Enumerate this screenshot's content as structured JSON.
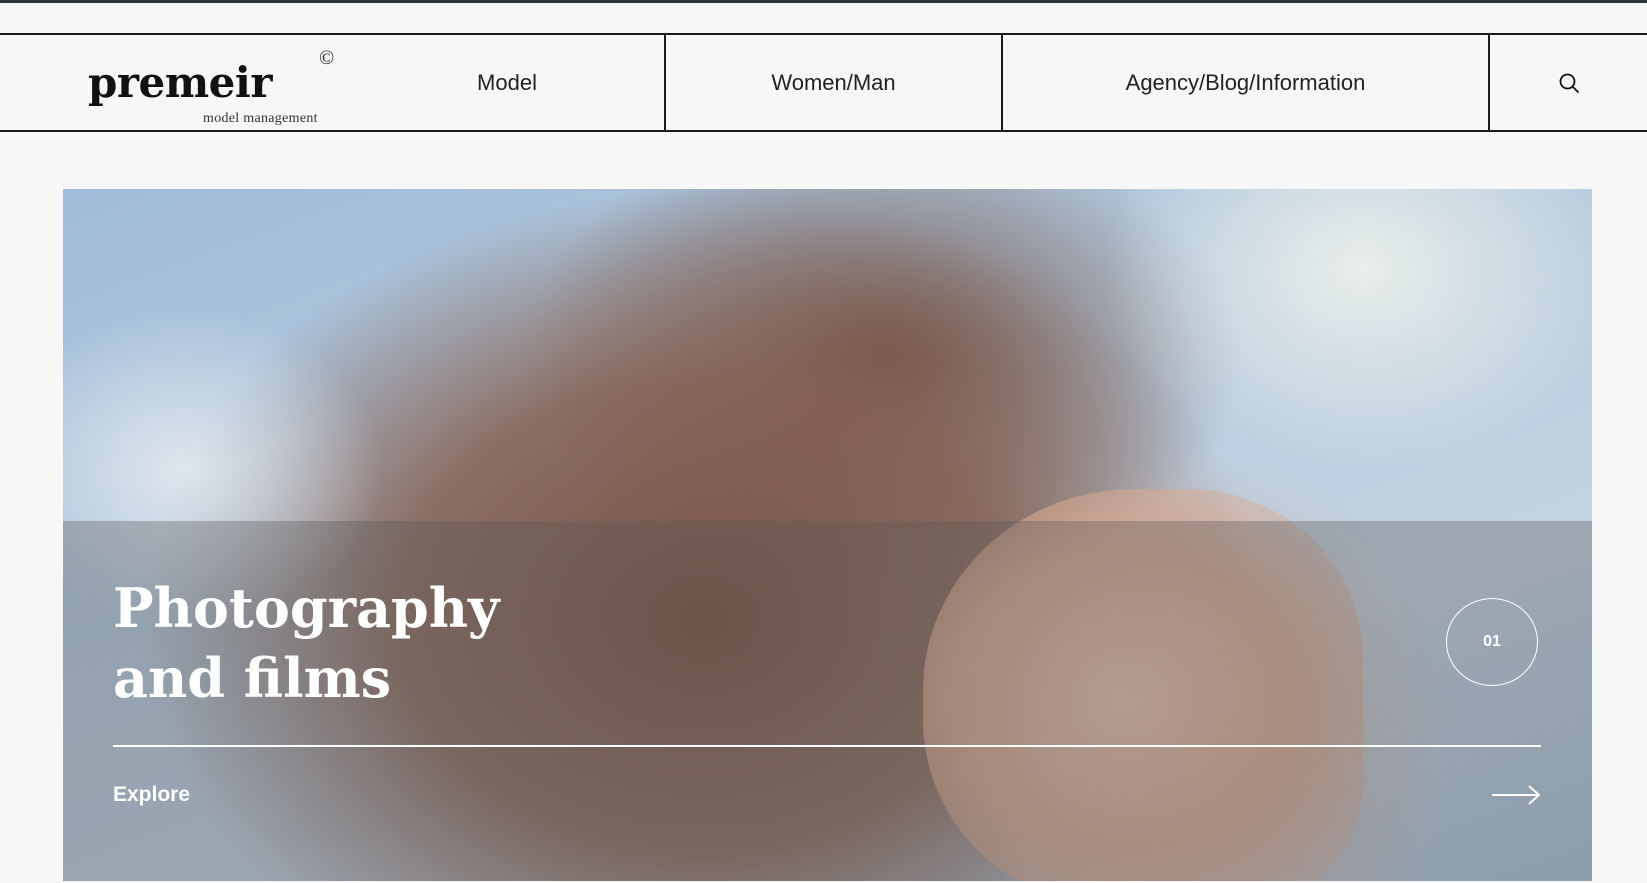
{
  "brand": {
    "name": "premeir",
    "copyright_mark": "©",
    "tagline": "model management"
  },
  "nav": {
    "items": [
      {
        "label": "Model"
      },
      {
        "label": "Women/Man"
      },
      {
        "label": "Agency/Blog/Information"
      }
    ],
    "search_icon": "search-icon"
  },
  "hero": {
    "title": "Photography\nand films",
    "slide_number": "01",
    "explore_label": "Explore",
    "explore_icon": "arrow-right-icon"
  },
  "colors": {
    "background": "#f7f7f7",
    "text": "#111111",
    "overlay_text": "#ffffff"
  }
}
